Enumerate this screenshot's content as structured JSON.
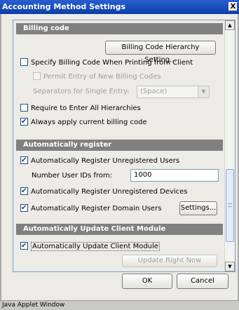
{
  "window": {
    "title": "Accounting Method Settings",
    "close_label": "X"
  },
  "billing": {
    "header": "Billing code",
    "hierarchy_button": "Billing Code Hierarchy Setting...",
    "specify_label": "Specify Billing Code When Printing from Client",
    "specify_checked": false,
    "permit_label": "Permit Entry of New Billing Codes",
    "separators_label": "Separators for Single Entry:",
    "separators_value": "(Space)",
    "require_label": "Require to Enter All Hierarchies",
    "require_checked": false,
    "always_label": "Always apply current billing code",
    "always_checked": true
  },
  "auto_register": {
    "header": "Automatically register",
    "users_label": "Automatically Register Unregistered Users",
    "users_checked": true,
    "number_label": "Number User IDs from:",
    "number_value": "1000",
    "devices_label": "Automatically Register Unregistered Devices",
    "devices_checked": true,
    "domain_label": "Automatically Register Domain Users",
    "domain_checked": true,
    "settings_button": "Settings..."
  },
  "auto_update": {
    "header": "Automatically Update Client Module",
    "update_label": "Automatically Update Client Module",
    "update_checked": true,
    "update_now_button": "Update Right Now"
  },
  "footer": {
    "ok": "OK",
    "cancel": "Cancel"
  },
  "status": "Java Applet Window"
}
